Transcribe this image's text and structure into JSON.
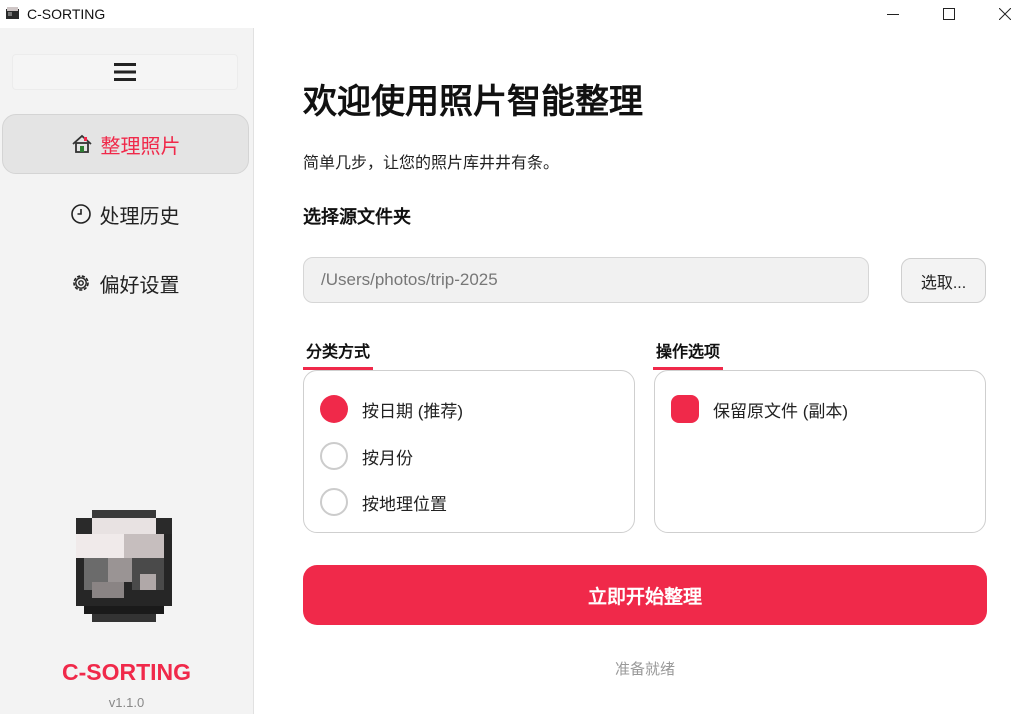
{
  "window": {
    "title": "C-SORTING"
  },
  "sidebar": {
    "items": [
      {
        "label": "整理照片",
        "icon": "home-icon",
        "active": true
      },
      {
        "label": "处理历史",
        "icon": "clock-icon",
        "active": false
      },
      {
        "label": "偏好设置",
        "icon": "gear-icon",
        "active": false
      }
    ],
    "brand": "C-SORTING",
    "version": "v1.1.0"
  },
  "main": {
    "title": "欢迎使用照片智能整理",
    "subtitle": "简单几步，让您的照片库井井有条。",
    "source_heading": "选择源文件夹",
    "source_path": "/Users/photos/trip-2025",
    "browse_label": "选取...",
    "sort_heading": "分类方式",
    "sort_options": [
      {
        "label": "按日期 (推荐)",
        "selected": true
      },
      {
        "label": "按月份",
        "selected": false
      },
      {
        "label": "按地理位置",
        "selected": false
      }
    ],
    "ops_heading": "操作选项",
    "ops_options": [
      {
        "label": "保留原文件 (副本)",
        "checked": true
      }
    ],
    "start_label": "立即开始整理",
    "status": "准备就绪"
  },
  "colors": {
    "accent": "#f0294a",
    "sidebar_bg": "#f3f3f3"
  }
}
